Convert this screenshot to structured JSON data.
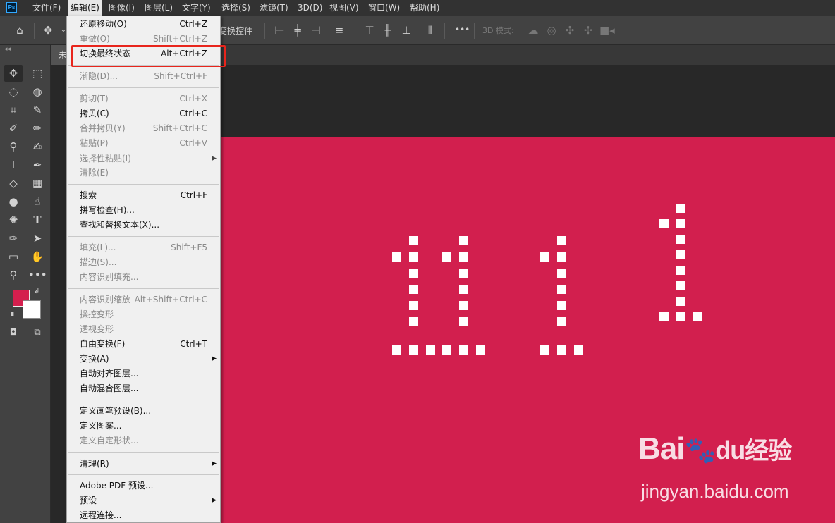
{
  "app": {
    "logo_text": "Ps"
  },
  "menubar": {
    "items": [
      "文件(F)",
      "编辑(E)",
      "图像(I)",
      "图层(L)",
      "文字(Y)",
      "选择(S)",
      "滤镜(T)",
      "3D(D)",
      "视图(V)",
      "窗口(W)",
      "帮助(H)"
    ],
    "active": "编辑(E)"
  },
  "optionsbar": {
    "transform_controls_label": "变换控件",
    "mode_label": "3D 模式:",
    "more_label": "•••"
  },
  "document": {
    "tab_label": "未"
  },
  "edit_menu": {
    "undo": {
      "label": "还原移动(O)",
      "shortcut": "Ctrl+Z"
    },
    "redo": {
      "label": "重做(O)",
      "shortcut": "Shift+Ctrl+Z"
    },
    "toggle_last": {
      "label": "切换最终状态",
      "shortcut": "Alt+Ctrl+Z"
    },
    "fade": {
      "label": "渐隐(D)...",
      "shortcut": "Shift+Ctrl+F"
    },
    "cut": {
      "label": "剪切(T)",
      "shortcut": "Ctrl+X"
    },
    "copy": {
      "label": "拷贝(C)",
      "shortcut": "Ctrl+C"
    },
    "copy_merged": {
      "label": "合并拷贝(Y)",
      "shortcut": "Shift+Ctrl+C"
    },
    "paste": {
      "label": "粘贴(P)",
      "shortcut": "Ctrl+V"
    },
    "paste_special": {
      "label": "选择性粘贴(I)"
    },
    "clear": {
      "label": "清除(E)"
    },
    "search": {
      "label": "搜索",
      "shortcut": "Ctrl+F"
    },
    "spell_check": {
      "label": "拼写检查(H)..."
    },
    "find_replace": {
      "label": "查找和替换文本(X)..."
    },
    "fill": {
      "label": "填充(L)...",
      "shortcut": "Shift+F5"
    },
    "stroke": {
      "label": "描边(S)..."
    },
    "content_aware_fill": {
      "label": "内容识别填充..."
    },
    "content_aware_scale": {
      "label": "内容识别缩放",
      "shortcut": "Alt+Shift+Ctrl+C"
    },
    "puppet_warp": {
      "label": "操控变形"
    },
    "perspective_warp": {
      "label": "透视变形"
    },
    "free_transform": {
      "label": "自由变换(F)",
      "shortcut": "Ctrl+T"
    },
    "transform": {
      "label": "变换(A)"
    },
    "auto_align": {
      "label": "自动对齐图层..."
    },
    "auto_blend": {
      "label": "自动混合图层..."
    },
    "define_brush": {
      "label": "定义画笔预设(B)..."
    },
    "define_pattern": {
      "label": "定义图案..."
    },
    "define_shape": {
      "label": "定义自定形状..."
    },
    "purge": {
      "label": "清理(R)"
    },
    "pdf_presets": {
      "label": "Adobe PDF 预设..."
    },
    "presets": {
      "label": "预设"
    },
    "remote": {
      "label": "远程连接..."
    }
  },
  "canvas": {
    "background_color": "#d21f4e",
    "glyph_color": "#ffffff"
  },
  "colors": {
    "foreground": "#d41f4e",
    "background": "#ffffff",
    "highlight_box": "#e8251c"
  },
  "watermark": {
    "brand": "Bai",
    "brand_du": "du",
    "suffix": "经验",
    "url": "jingyan.baidu.com"
  }
}
